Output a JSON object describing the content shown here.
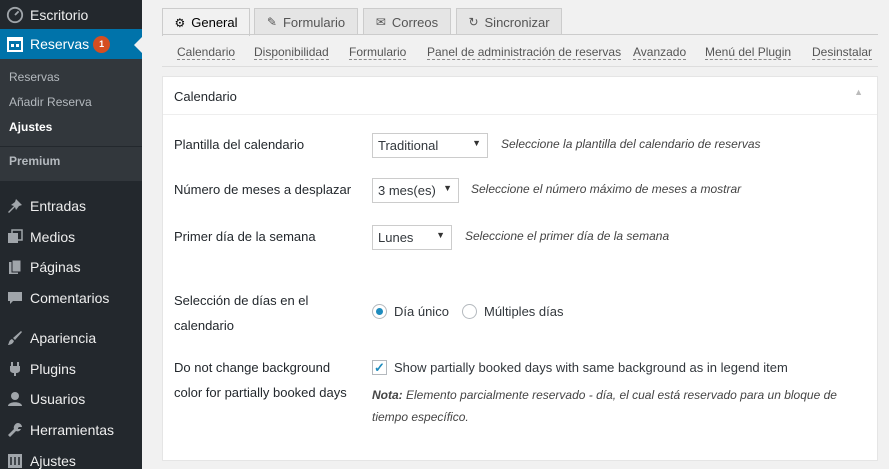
{
  "sidebar": {
    "items": [
      {
        "label": "Escritorio",
        "icon": "dashboard-icon"
      },
      {
        "label": "Reservas",
        "icon": "calendar-icon",
        "badge": "1"
      },
      {
        "label": "Entradas",
        "icon": "pin-icon"
      },
      {
        "label": "Medios",
        "icon": "media-icon"
      },
      {
        "label": "Páginas",
        "icon": "page-icon"
      },
      {
        "label": "Comentarios",
        "icon": "comment-icon"
      },
      {
        "label": "Apariencia",
        "icon": "brush-icon"
      },
      {
        "label": "Plugins",
        "icon": "plug-icon"
      },
      {
        "label": "Usuarios",
        "icon": "user-icon"
      },
      {
        "label": "Herramientas",
        "icon": "wrench-icon"
      },
      {
        "label": "Ajustes",
        "icon": "settings-icon"
      }
    ],
    "submenu": [
      "Reservas",
      "Añadir Reserva",
      "Ajustes",
      "Premium"
    ]
  },
  "tabs": [
    {
      "label": "General",
      "icon": "gear-icon"
    },
    {
      "label": "Formulario",
      "icon": "edit-icon"
    },
    {
      "label": "Correos",
      "icon": "mail-icon"
    },
    {
      "label": "Sincronizar",
      "icon": "sync-icon"
    }
  ],
  "subnav": [
    "Calendario",
    "Disponibilidad",
    "Formulario",
    "Panel de administración de reservas",
    "Avanzado",
    "Menú del Plugin",
    "Desinstalar"
  ],
  "panel": {
    "title": "Calendario",
    "toggle": "▲",
    "template": {
      "label": "Plantilla del calendario",
      "value": "Traditional",
      "desc": "Seleccione la plantilla del calendario de reservas"
    },
    "months": {
      "label": "Número de meses a desplazar",
      "value": "3 mes(es)",
      "desc": "Seleccione el número máximo de meses a mostrar"
    },
    "firstday": {
      "label": "Primer día de la semana",
      "value": "Lunes",
      "desc": "Seleccione el primer día de la semana"
    },
    "selection": {
      "label_line1": "Selección de días en el",
      "label_line2": "calendario",
      "option1": "Día único",
      "option2": "Múltiples días"
    },
    "background": {
      "label_line1": "Do not change background",
      "label_line2": "color for partially booked days",
      "checkbox_label": "Show partially booked days with same background as in legend item",
      "note_bold": "Nota:",
      "note_line1": " Elemento parcialmente reservado - día, el cual está reservado para un bloque de",
      "note_line2": "tiempo específico."
    }
  },
  "colors": {
    "sidebar": "#23282d",
    "active": "#0073aa",
    "badge": "#d54e21",
    "accent": "#1e8cbe"
  }
}
